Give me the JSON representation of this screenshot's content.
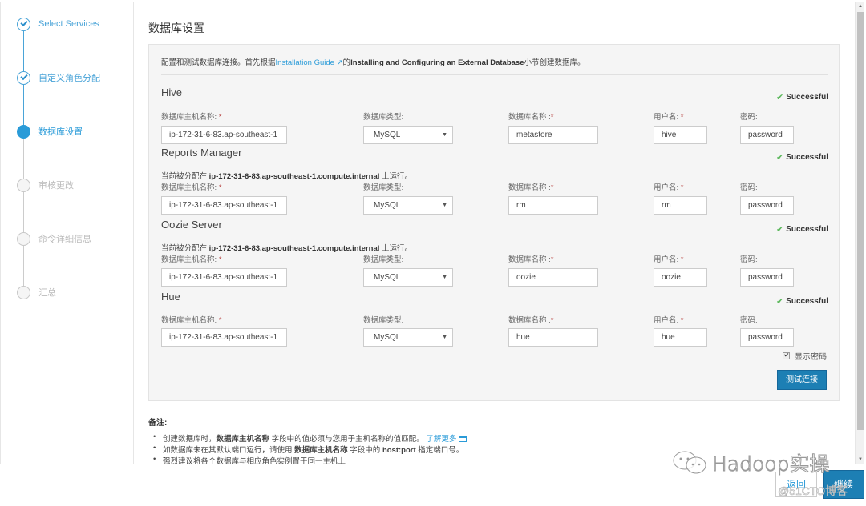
{
  "steps": [
    {
      "label": "Select Services",
      "state": "done"
    },
    {
      "label": "自定义角色分配",
      "state": "done"
    },
    {
      "label": "数据库设置",
      "state": "active"
    },
    {
      "label": "审核更改",
      "state": "pending"
    },
    {
      "label": "命令详细信息",
      "state": "pending"
    },
    {
      "label": "汇总",
      "state": "pending"
    }
  ],
  "page": {
    "title": "数据库设置",
    "intro": {
      "prefix": "配置和测试数据库连接。首先根据",
      "link": "Installation Guide",
      "mid": "的",
      "bold": "Installing and Configuring an External Database",
      "suffix": "小节创建数据库。"
    }
  },
  "labels": {
    "host": "数据库主机名称:",
    "type": "数据库类型:",
    "dbname": "数据库名称 :",
    "user": "用户名:",
    "password": "密码:",
    "required": "*",
    "assigned_prefix": "当前被分配在 ",
    "assigned_suffix": " 上运行。"
  },
  "services": [
    {
      "name": "Hive",
      "status": "Successful",
      "assigned_host": "",
      "host": "ip-172-31-6-83.ap-southeast-1",
      "type": "MySQL",
      "dbname": "metastore",
      "user": "hive",
      "password": "password"
    },
    {
      "name": "Reports Manager",
      "status": "Successful",
      "assigned_host": "ip-172-31-6-83.ap-southeast-1.compute.internal",
      "host": "ip-172-31-6-83.ap-southeast-1",
      "type": "MySQL",
      "dbname": "rm",
      "user": "rm",
      "password": "password"
    },
    {
      "name": "Oozie Server",
      "status": "Successful",
      "assigned_host": "ip-172-31-6-83.ap-southeast-1.compute.internal",
      "host": "ip-172-31-6-83.ap-southeast-1",
      "type": "MySQL",
      "dbname": "oozie",
      "user": "oozie",
      "password": "password"
    },
    {
      "name": "Hue",
      "status": "Successful",
      "assigned_host": "",
      "host": "ip-172-31-6-83.ap-southeast-1",
      "type": "MySQL",
      "dbname": "hue",
      "user": "hue",
      "password": "password"
    }
  ],
  "show_password": {
    "label": "显示密码",
    "checked": true
  },
  "test_button": "测试连接",
  "notes": {
    "title": "备注:",
    "items": [
      {
        "a": "创建数据库时，",
        "b": "数据库主机名称",
        "c": " 字段中的值必须与您用于主机名称的值匹配。 ",
        "link": "了解更多"
      },
      {
        "a": "如数据库未在其默认端口运行，请使用 ",
        "b": "数据库主机名称",
        "c": " 字段中的 ",
        "d": "host:port",
        "e": " 指定端口号。"
      },
      {
        "a": "强烈建议将各个数据库与相应角色实例置于同一主机上"
      }
    ]
  },
  "footer": {
    "back": "返回",
    "next": "继续"
  },
  "watermark": {
    "main": "Hadoop实操",
    "sub": "@51CTO博客"
  }
}
